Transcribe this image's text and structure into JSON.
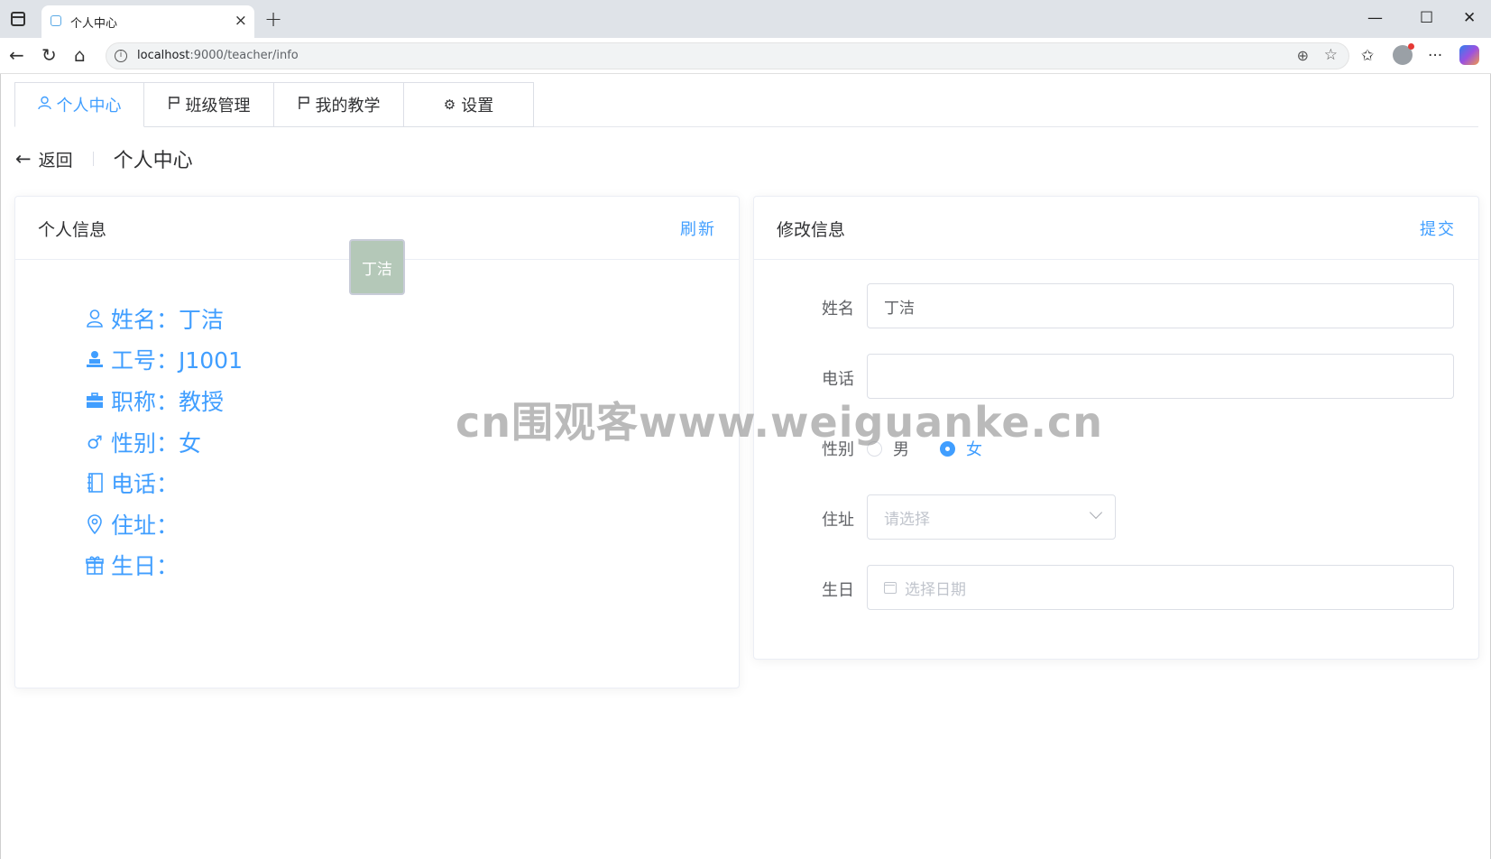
{
  "browser": {
    "tab_title": "个人中心",
    "tab_close": "×",
    "new_tab": "+",
    "url_host": "localhost",
    "url_rest": ":9000/teacher/info",
    "win_minimize": "—",
    "win_maximize": "☐",
    "win_close": "✕",
    "more": "···"
  },
  "nav": {
    "tabs": [
      {
        "label": "个人中心",
        "icon": "user-icon",
        "active": true
      },
      {
        "label": "班级管理",
        "icon": "flag-icon"
      },
      {
        "label": "我的教学",
        "icon": "flag-icon"
      },
      {
        "label": "设置",
        "icon": "gear-icon"
      }
    ]
  },
  "header": {
    "back_label": "返回",
    "title": "个人中心"
  },
  "info_card": {
    "title": "个人信息",
    "action": "刷新",
    "avatar_text": "丁洁",
    "rows": [
      {
        "icon": "user-icon",
        "text": "姓名：丁洁"
      },
      {
        "icon": "stamp-icon",
        "text": "工号：J1001"
      },
      {
        "icon": "briefcase-icon",
        "text": "职称：教授"
      },
      {
        "icon": "male-icon",
        "text": "性别：女"
      },
      {
        "icon": "notebook-icon",
        "text": "电话："
      },
      {
        "icon": "location-icon",
        "text": "住址："
      },
      {
        "icon": "present-icon",
        "text": "生日："
      }
    ]
  },
  "edit_card": {
    "title": "修改信息",
    "action": "提交",
    "name_label": "姓名",
    "name_value": "丁洁",
    "phone_label": "电话",
    "phone_value": "",
    "gender_label": "性别",
    "gender_options": [
      "男",
      "女"
    ],
    "gender_selected": "女",
    "address_label": "住址",
    "address_placeholder": "请选择",
    "birthday_label": "生日",
    "birthday_placeholder": "选择日期"
  },
  "watermark": "cn围观客www.weiguanke.cn",
  "colors": {
    "accent": "#409eff",
    "text": "#303133",
    "border": "#dcdfe6"
  }
}
